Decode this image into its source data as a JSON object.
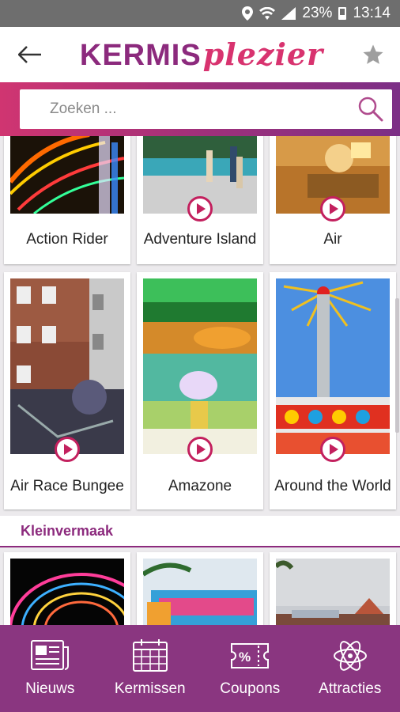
{
  "status_bar": {
    "battery": "23%",
    "time": "13:14"
  },
  "app_bar": {
    "logo_part1": "KERMIS",
    "logo_part2": "plezier"
  },
  "search": {
    "placeholder": "Zoeken ..."
  },
  "attractions": [
    {
      "name": "Action Rider"
    },
    {
      "name": "Adventure Island"
    },
    {
      "name": "Air"
    },
    {
      "name": "Air Race Bungee"
    },
    {
      "name": "Amazone"
    },
    {
      "name": "Around the World"
    }
  ],
  "section": {
    "title": "Kleinvermaak"
  },
  "nav": [
    {
      "label": "Nieuws",
      "icon": "newspaper-icon"
    },
    {
      "label": "Kermissen",
      "icon": "calendar-icon"
    },
    {
      "label": "Coupons",
      "icon": "coupon-icon"
    },
    {
      "label": "Attracties",
      "icon": "atom-icon"
    }
  ],
  "colors": {
    "brand_purple": "#8c2a7d",
    "brand_pink": "#d03571",
    "nav_bg": "#8a3680",
    "play_red": "#c3205e"
  }
}
